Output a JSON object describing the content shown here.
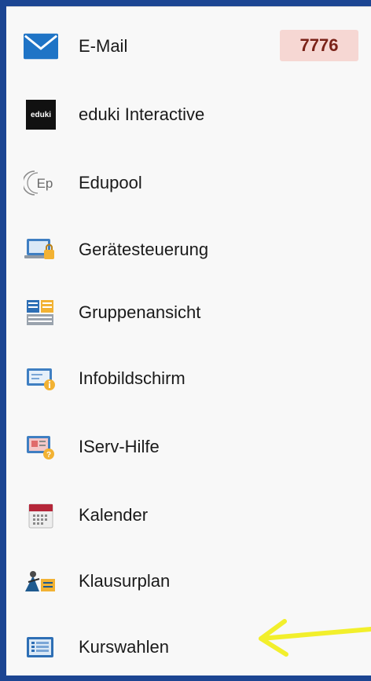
{
  "colors": {
    "frame": "#1c4592",
    "panel": "#f8f8f8",
    "badge_bg": "#f6d7d3",
    "badge_text": "#7a2218",
    "arrow": "#f2ef2c"
  },
  "menu": {
    "items": [
      {
        "label": "E-Mail",
        "icon": "mail-icon",
        "badge": "7776"
      },
      {
        "label": "eduki Interactive",
        "icon": "eduki-logo-icon",
        "logo_text": "eduki"
      },
      {
        "label": "Edupool",
        "icon": "edupool-logo-icon",
        "logo_text": "Ep"
      },
      {
        "label": "Gerätesteuerung",
        "icon": "device-control-icon"
      },
      {
        "label": "Gruppenansicht",
        "icon": "group-view-icon"
      },
      {
        "label": "Infobildschirm",
        "icon": "info-screen-icon"
      },
      {
        "label": "IServ-Hilfe",
        "icon": "help-icon"
      },
      {
        "label": "Kalender",
        "icon": "calendar-icon"
      },
      {
        "label": "Klausurplan",
        "icon": "exam-plan-icon"
      },
      {
        "label": "Kurswahlen",
        "icon": "course-selection-icon"
      }
    ]
  },
  "annotation": {
    "icon": "yellow-arrow-pointer"
  }
}
